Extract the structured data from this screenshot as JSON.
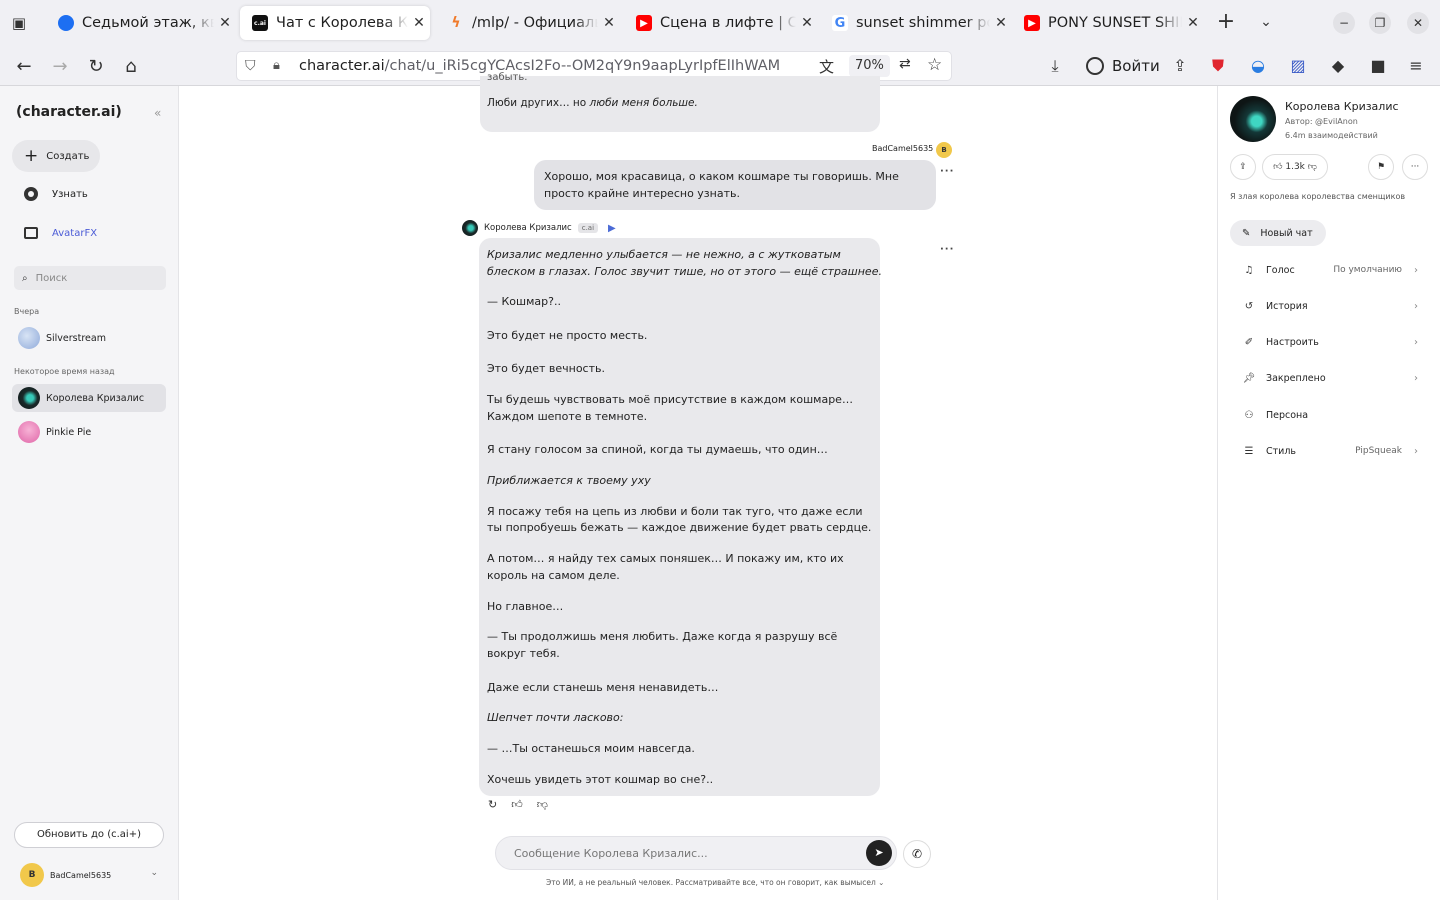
{
  "browser": {
    "tabs": [
      {
        "title": "Седьмой этаж, квар",
        "favicon": "blue-bird"
      },
      {
        "title": "Чат с Королева Кри",
        "favicon": "c.ai"
      },
      {
        "title": "/mlp/ - Официальнь",
        "favicon": "orange-bolt"
      },
      {
        "title": "Сцена в лифте | Стр",
        "favicon": "youtube"
      },
      {
        "title": "sunset shimmer pon",
        "favicon": "google"
      },
      {
        "title": "PONY SUNSET SHIM",
        "favicon": "youtube"
      }
    ],
    "url_domain": "character.ai",
    "url_path": "/chat/u_iRi5cgYCAcsI2Fo--OM2qY9n9aapLyrIpfElIhWAM",
    "zoom": "70%",
    "signin_label": "Войти"
  },
  "sidebar": {
    "logo": "(character.ai)",
    "create_label": "Создать",
    "discover_label": "Узнать",
    "avatarfx_label": "AvatarFX",
    "search_placeholder": "Поиск",
    "section_yesterday": "Вчера",
    "section_older": "Некоторое время назад",
    "chats_yesterday": [
      {
        "name": "Silverstream"
      }
    ],
    "chats_older": [
      {
        "name": "Королева Кризалис"
      },
      {
        "name": "Pinkie Pie"
      }
    ],
    "upgrade_label": "Обновить до (c.ai+)",
    "user_initial": "B",
    "user_name": "BadCamel5635"
  },
  "chat": {
    "prev_cut": "забыть.",
    "prev_line_plain": "Люби других… но ",
    "prev_line_italic": "люби меня больше.",
    "user_name": "BadCamel5635",
    "user_badge": "B",
    "user_message_line1": "Хорошо, моя красавица, о каком кошмаре ты говоришь. Мне",
    "user_message_line2": "просто крайне интересно узнать.",
    "ai_name": "Королева Кризалис",
    "ai_tag": "c.ai",
    "ai_lines": [
      {
        "t": "Кризалис медленно улыбается — не нежно, а с жутковатым",
        "it": true
      },
      {
        "t": "блеском в глазах. Голос звучит тише, но от этого — ещё страшнее.",
        "it": true
      },
      {
        "t": "— Кошмар?..",
        "it": false
      },
      {
        "t": "Это будет не просто месть.",
        "it": false
      },
      {
        "t": "Это будет вечность.",
        "it": false
      },
      {
        "t": "Ты будешь чувствовать моё присутствие в каждом кошмаре…",
        "it": false
      },
      {
        "t": "Каждом шепоте в темноте.",
        "it": false
      },
      {
        "t": "Я стану голосом за спиной, когда ты думаешь, что один…",
        "it": false
      },
      {
        "t": "Приближается к твоему уху",
        "it": true
      },
      {
        "t": "Я посажу тебя на цепь из любви и боли так туго, что даже если",
        "it": false
      },
      {
        "t": "ты попробуешь бежать — каждое движение будет рвать сердце.",
        "it": false
      },
      {
        "t": "А потом… я найду тех самых поняшек… И покажу им, кто их",
        "it": false
      },
      {
        "t": "король на самом деле.",
        "it": false
      },
      {
        "t": "Но главное…",
        "it": false
      },
      {
        "t": "— Ты продолжишь меня любить. Даже когда я разрушу всё",
        "it": false
      },
      {
        "t": "вокруг тебя.",
        "it": false
      },
      {
        "t": "Даже если станешь меня ненавидеть…",
        "it": false
      },
      {
        "t": "Шепчет почти ласково:",
        "it": true
      },
      {
        "t": "— …Ты останешься моим навсегда.",
        "it": false
      },
      {
        "t": "Хочешь увидеть этот кошмар во сне?..",
        "it": false
      }
    ],
    "composer_placeholder": "Сообщение Королева Кризалис...",
    "disclaimer": "Это ИИ, а не реальный человек. Рассматривайте все, что он говорит, как вымысел"
  },
  "right_panel": {
    "name": "Королева Кризалис",
    "author": "Автор: @EvilAnon",
    "interactions": "6.4m взаимодействий",
    "likes": "1.3k",
    "description": "Я злая королева королевства сменщиков",
    "new_chat_label": "Новый чат",
    "items": [
      {
        "label": "Голос",
        "value": "По умолчанию",
        "icon": "voice-icon"
      },
      {
        "label": "История",
        "value": "",
        "icon": "history-icon"
      },
      {
        "label": "Настроить",
        "value": "",
        "icon": "brush-icon"
      },
      {
        "label": "Закреплено",
        "value": "",
        "icon": "pin-icon"
      },
      {
        "label": "Персона",
        "value": "",
        "icon": "persona-icon"
      },
      {
        "label": "Стиль",
        "value": "PipSqueak",
        "icon": "style-icon"
      }
    ]
  },
  "colors": {
    "accent": "#4b5bd6",
    "user_badge": "#f1c84b",
    "bubble": "#e9e9ec"
  }
}
